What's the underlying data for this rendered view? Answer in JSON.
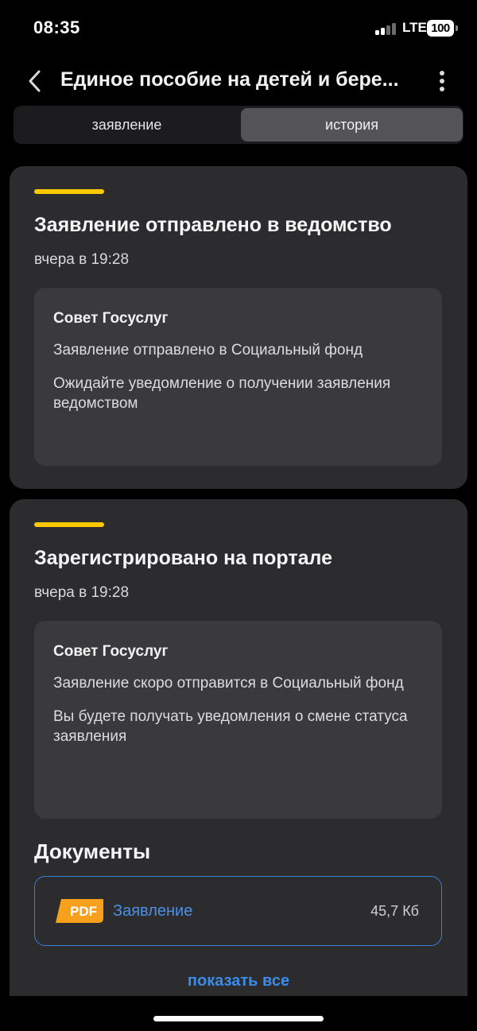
{
  "status_bar": {
    "time": "08:35",
    "network": "LTE",
    "battery": "100"
  },
  "header": {
    "title": "Единое пособие на детей и бере..."
  },
  "tabs": [
    {
      "label": "заявление",
      "active": false
    },
    {
      "label": "история",
      "active": true
    }
  ],
  "colors": {
    "accent": "#ffc800",
    "link": "#3c8be8",
    "pdf": "#f7a01b"
  },
  "events": [
    {
      "title": "Заявление отправлено в ведомство",
      "time": "вчера в 19:28",
      "advice": {
        "title": "Совет Госуслуг",
        "lines": [
          "Заявление отправлено в Социальный фонд",
          "Ожидайте уведомление о получении заявления ведомством"
        ]
      }
    },
    {
      "title": "Зарегистрировано на портале",
      "time": "вчера в 19:28",
      "advice": {
        "title": "Совет Госуслуг",
        "lines": [
          "Заявление скоро отправится в Социальный фонд",
          "Вы будете получать уведомления о смене статуса заявления"
        ]
      }
    }
  ],
  "documents": {
    "title": "Документы",
    "items": [
      {
        "icon_label": "PDF",
        "name": "Заявление",
        "size": "45,7 Кб"
      }
    ],
    "show_all": "показать все"
  }
}
